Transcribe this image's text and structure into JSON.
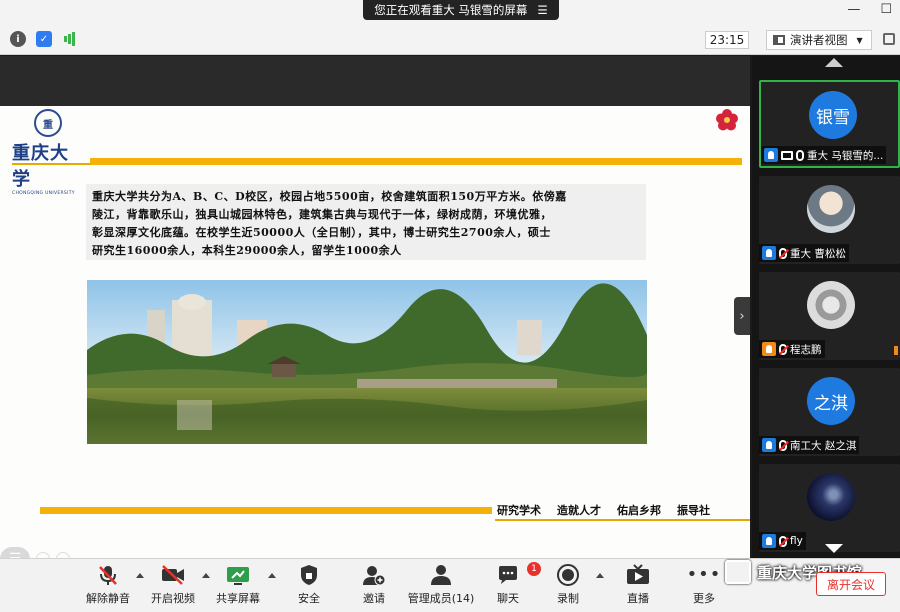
{
  "top_bar": {
    "share_banner_text": "您正在观看重大 马银雪的屏幕",
    "time": "23:15",
    "view_button_label": "演讲者视图"
  },
  "slide": {
    "logo_cn": "重庆大学",
    "logo_en": "CHONGQING UNIVERSITY",
    "intro_lines": [
      "重庆大学共分为A、B、C、D校区，校园占地5500亩，校舍建筑面积150万平方米。依傍嘉",
      "陵江，背靠歌乐山，独具山城园林特色，建筑集古典与现代于一体，绿树成荫，环境优雅，",
      "彰显深厚文化底蕴。在校学生近50000人（全日制），其中，博士研究生2700余人，硕士",
      "研究生16000余人，本科生29000余人，留学生1000余人"
    ],
    "mottos": [
      "研究学术",
      "造就人才",
      "佑启乡邦",
      "振导社"
    ]
  },
  "participants": [
    {
      "avatar_text": "银雪",
      "avatar_style": "blue",
      "name": "重大 马银雪的...",
      "muted": false,
      "sharing": true,
      "active": true,
      "badge_color": "blue"
    },
    {
      "avatar_text": "",
      "avatar_style": "photo1",
      "name": "重大 曹松松",
      "muted": true,
      "sharing": false,
      "active": false,
      "badge_color": "blue"
    },
    {
      "avatar_text": "",
      "avatar_style": "photo2",
      "name": "程志鹏",
      "muted": true,
      "sharing": false,
      "active": false,
      "badge_color": "orange"
    },
    {
      "avatar_text": "之淇",
      "avatar_style": "blue",
      "name": "南工大 赵之淇",
      "muted": true,
      "sharing": false,
      "active": false,
      "badge_color": "blue"
    },
    {
      "avatar_text": "",
      "avatar_style": "galaxy",
      "name": "fly",
      "muted": true,
      "sharing": false,
      "active": false,
      "badge_color": "blue"
    }
  ],
  "toolbar": {
    "unmute": "解除静音",
    "start_video": "开启视频",
    "share_screen": "共享屏幕",
    "security": "安全",
    "invite": "邀请",
    "manage_members": "管理成员(14)",
    "chat": "聊天",
    "chat_badge": "1",
    "record": "录制",
    "live": "直播",
    "more": "更多",
    "leave": "离开会议"
  },
  "watermark": "重庆大学图书馆"
}
